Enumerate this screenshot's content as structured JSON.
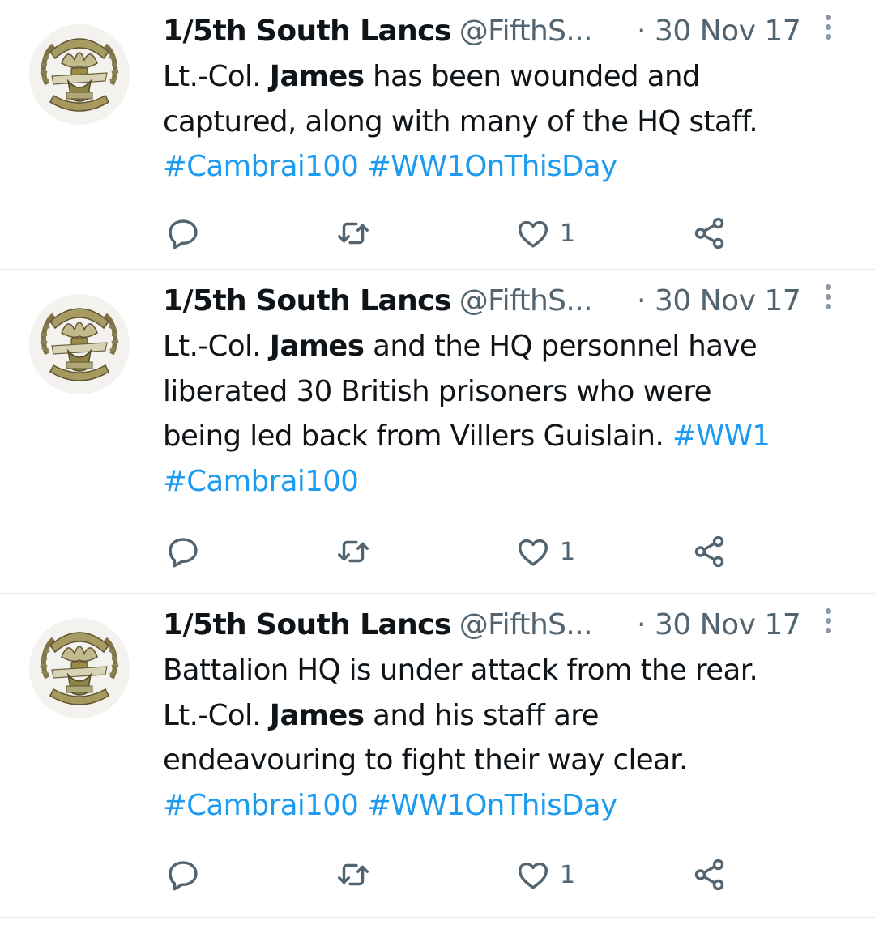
{
  "tweets": [
    {
      "author_name": "1/5th South Lancs",
      "handle": "@FifthS...",
      "separator": "·",
      "date": "30 Nov 17",
      "lines": [
        [
          {
            "text": "Lt.-Col. ",
            "style": "plain"
          },
          {
            "text": "James",
            "style": "bold"
          },
          {
            "text": " has been wounded and",
            "style": "plain"
          }
        ],
        [
          {
            "text": "captured, along with many of the HQ staff.",
            "style": "plain"
          }
        ],
        [
          {
            "text": "#Cambrai100",
            "style": "tag"
          },
          {
            "text": " ",
            "style": "plain"
          },
          {
            "text": "#WW1OnThisDay",
            "style": "tag"
          }
        ]
      ],
      "like_count": "1"
    },
    {
      "author_name": "1/5th South Lancs",
      "handle": "@FifthS...",
      "separator": "·",
      "date": "30 Nov 17",
      "lines": [
        [
          {
            "text": "Lt.-Col. ",
            "style": "plain"
          },
          {
            "text": "James",
            "style": "bold"
          },
          {
            "text": " and the HQ personnel have",
            "style": "plain"
          }
        ],
        [
          {
            "text": "liberated 30 British prisoners who were",
            "style": "plain"
          }
        ],
        [
          {
            "text": "being led back from Villers Guislain. ",
            "style": "plain"
          },
          {
            "text": "#WW1",
            "style": "tag"
          }
        ],
        [
          {
            "text": "#Cambrai100",
            "style": "tag"
          }
        ]
      ],
      "like_count": "1"
    },
    {
      "author_name": "1/5th South Lancs",
      "handle": "@FifthS...",
      "separator": "·",
      "date": "30 Nov 17",
      "lines": [
        [
          {
            "text": "Battalion HQ is under attack from the rear.",
            "style": "plain"
          }
        ],
        [
          {
            "text": "Lt.-Col. ",
            "style": "plain"
          },
          {
            "text": "James",
            "style": "bold"
          },
          {
            "text": " and his staff are",
            "style": "plain"
          }
        ],
        [
          {
            "text": "endeavouring to fight their way clear.",
            "style": "plain"
          }
        ],
        [
          {
            "text": "#Cambrai100",
            "style": "tag"
          },
          {
            "text": " ",
            "style": "plain"
          },
          {
            "text": "#WW1OnThisDay",
            "style": "tag"
          }
        ]
      ],
      "like_count": "1"
    }
  ],
  "icons": {
    "avatar": "regimental-badge-avatar",
    "more": "more-vertical-icon",
    "reply": "reply-icon",
    "retweet": "retweet-icon",
    "like": "heart-icon",
    "share": "share-icon"
  },
  "colors": {
    "text": "#0f1419",
    "secondary": "#536471",
    "hashtag": "#1d9bf0",
    "divider": "#e6e9ec"
  }
}
